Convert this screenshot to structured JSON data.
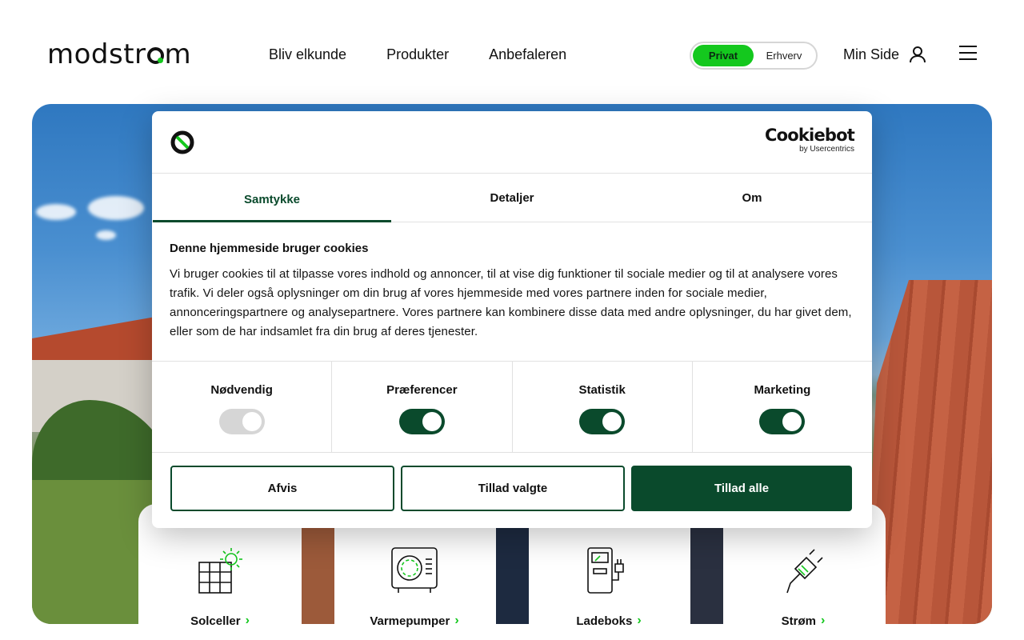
{
  "header": {
    "logo_text": "modstrom",
    "nav": [
      "Bliv elkunde",
      "Produkter",
      "Anbefaleren"
    ],
    "segment": {
      "active": "Privat",
      "inactive": "Erhverv"
    },
    "min_side": "Min Side"
  },
  "cards": [
    {
      "label": "Solceller",
      "icon": "solar-panel-icon"
    },
    {
      "label": "Varmepumper",
      "icon": "heat-pump-icon"
    },
    {
      "label": "Ladeboks",
      "icon": "charger-icon"
    },
    {
      "label": "Strøm",
      "icon": "plug-icon"
    }
  ],
  "cookie": {
    "brand_name": "Cookiebot",
    "brand_by": "by Usercentrics",
    "tabs": [
      "Samtykke",
      "Detaljer",
      "Om"
    ],
    "active_tab": "Samtykke",
    "heading": "Denne hjemmeside bruger cookies",
    "body": "Vi bruger cookies til at tilpasse vores indhold og annoncer, til at vise dig funktioner til sociale medier og til at analysere vores trafik. Vi deler også oplysninger om din brug af vores hjemmeside med vores partnere inden for sociale medier, annonceringspartnere og analysepartnere. Vores partnere kan kombinere disse data med andre oplysninger, du har givet dem, eller som de har indsamlet fra din brug af deres tjenester.",
    "toggles": [
      {
        "label": "Nødvendig",
        "on": true,
        "disabled": true
      },
      {
        "label": "Præferencer",
        "on": true,
        "disabled": false
      },
      {
        "label": "Statistik",
        "on": true,
        "disabled": false
      },
      {
        "label": "Marketing",
        "on": true,
        "disabled": false
      }
    ],
    "buttons": {
      "deny": "Afvis",
      "allow_selected": "Tillad valgte",
      "allow_all": "Tillad alle"
    }
  },
  "colors": {
    "brand_green": "#14c81e",
    "dark_green": "#0a4a2c"
  }
}
